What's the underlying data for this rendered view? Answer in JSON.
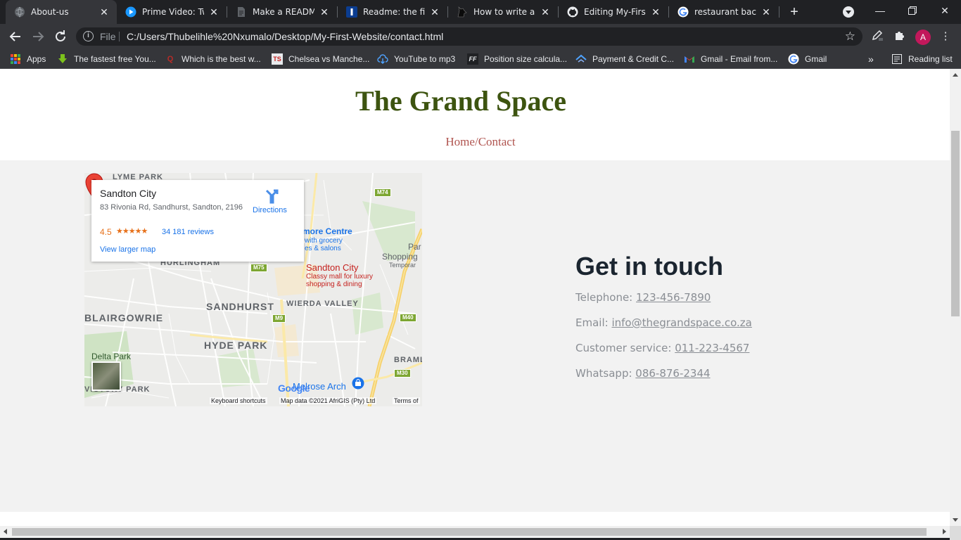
{
  "browser": {
    "tabs": [
      {
        "title": "About-us",
        "favicon": "globe-icon",
        "active": true
      },
      {
        "title": "Prime Video: Two",
        "favicon": "prime-video-icon"
      },
      {
        "title": "Make a README",
        "favicon": "document-icon"
      },
      {
        "title": "Readme: the file t",
        "favicon": "readme-icon"
      },
      {
        "title": "How to write a go",
        "favicon": "dog-icon"
      },
      {
        "title": "Editing My-First-V",
        "favicon": "github-icon"
      },
      {
        "title": "restaurant backg",
        "favicon": "google-icon"
      }
    ],
    "address": {
      "scheme": "File",
      "url": "C:/Users/Thubelihle%20Nxumalo/Desktop/My-First-Website/contact.html"
    },
    "profile_initial": "A",
    "bookmarks": [
      {
        "label": "Apps",
        "icon": "apps-grid-icon"
      },
      {
        "label": "The fastest free You...",
        "icon": "download-arrow-icon"
      },
      {
        "label": "Which is the best w...",
        "icon": "quora-icon"
      },
      {
        "label": "Chelsea vs Manche...",
        "icon": "ts-icon"
      },
      {
        "label": "YouTube to mp3",
        "icon": "cloud-download-icon"
      },
      {
        "label": "Position size calcula...",
        "icon": "ff-icon"
      },
      {
        "label": "Payment & Credit C...",
        "icon": "payment-icon"
      },
      {
        "label": "Gmail - Email from...",
        "icon": "gmail-icon"
      },
      {
        "label": "Gmail",
        "icon": "google-icon"
      }
    ],
    "reading_list": "Reading list"
  },
  "page": {
    "site_title": "The Grand Space",
    "breadcrumb": {
      "home": "Home",
      "sep": "/",
      "current": "Contact"
    },
    "map": {
      "place_name": "Sandton City",
      "address": "83 Rivonia Rd, Sandhurst, Sandton, 2196",
      "rating": "4.5",
      "stars": "★★★★★",
      "reviews": "34 181 reviews",
      "view_larger": "View larger map",
      "directions": "Directions",
      "poi_name": "Sandton City",
      "poi_desc_1": "Classy mall for luxury",
      "poi_desc_2": "shopping & dining",
      "areas": [
        "LYME PARK",
        "HURLINGHAM",
        "SANDHURST",
        "WIERDA VALLEY",
        "BLAIRGOWRIE",
        "HYDE PARK",
        "VICTORY PARK",
        "BRAML"
      ],
      "routes": [
        "M74",
        "M75",
        "M9",
        "M40",
        "M30"
      ],
      "mall_name": "more Centre",
      "mall_desc_1": "with grocery",
      "mall_desc_2": "es & salons",
      "shopping": "Shopping",
      "shopping_sub": "Temporar",
      "park": "Par",
      "delta_park": "Delta Park",
      "melrose": "Melrose Arch",
      "google": "Google",
      "attr_shortcuts": "Keyboard shortcuts",
      "attr_data": "Map data ©2021 AfriGIS (Pty) Ltd",
      "attr_terms": "Terms of"
    },
    "contact": {
      "heading": "Get in touch",
      "lines": [
        {
          "label": "Telephone: ",
          "value": "123-456-7890"
        },
        {
          "label": "Email: ",
          "value": "info@thegrandspace.co.za"
        },
        {
          "label": "Customer service: ",
          "value": "011-223-4567"
        },
        {
          "label": "Whatsapp: ",
          "value": "086-876-2344"
        }
      ]
    }
  },
  "colors": {
    "title": "#3d5410",
    "breadcrumb": "#b0544f",
    "contact_heading": "#1b2530",
    "contact_text": "#8a8e94"
  }
}
